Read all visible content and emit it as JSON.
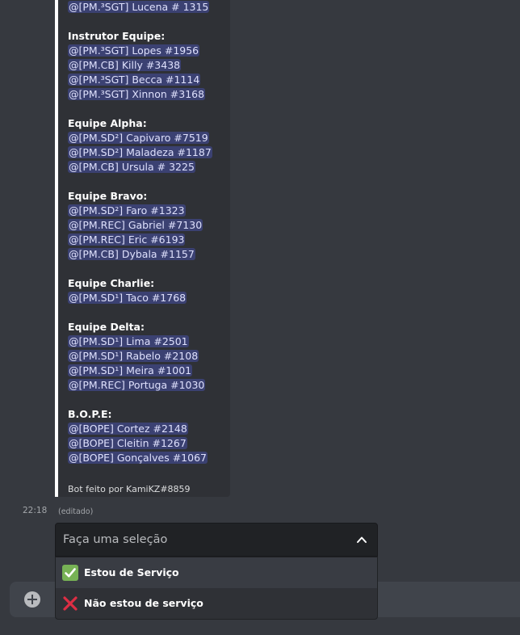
{
  "embed": {
    "first_mention": "@[PM.³SGT] Lucena # 1315",
    "sections": [
      {
        "title": "Instrutor Equipe:",
        "members": [
          "@[PM.³SGT] Lopes #1956",
          "@[PM.CB] Killy #3438",
          "@[PM.³SGT] Becca #1114",
          "@[PM.³SGT] Xinnon #3168"
        ]
      },
      {
        "title": "Equipe Alpha:",
        "members": [
          "@[PM.SD²] Capivaro #7519",
          "@[PM.SD²] Maladeza #1187",
          "@[PM.CB] Ursula # 3225"
        ]
      },
      {
        "title": "Equipe Bravo:",
        "members": [
          "@[PM.SD²] Faro #1323",
          "@[PM.REC] Gabriel #7130",
          "@[PM.REC] Eric #6193",
          "@[PM.CB] Dybala #1157"
        ]
      },
      {
        "title": "Equipe Charlie:",
        "members": [
          "@[PM.SD¹] Taco #1768"
        ]
      },
      {
        "title": "Equipe Delta:",
        "members": [
          "@[PM.SD¹] Lima #2501",
          "@[PM.SD¹] Rabelo #2108",
          "@[PM.SD¹] Meira #1001",
          "@[PM.REC] Portuga #1030"
        ]
      },
      {
        "title": "B.O.P.E:",
        "members": [
          "@[BOPE] Cortez #2148",
          "@[BOPE] Cleitin #1267",
          "@[BOPE] Gonçalves #1067"
        ]
      }
    ],
    "footer": "Bot feito por KamiKZ#8859"
  },
  "message": {
    "timestamp": "22:18",
    "edited": "(editado)"
  },
  "select": {
    "placeholder": "Faça uma seleção",
    "options": [
      {
        "label": "Estou de Serviço",
        "icon": "check-mark-icon",
        "color": "#77b255"
      },
      {
        "label": "Não estou de serviço",
        "icon": "cross-mark-icon",
        "color": "#dd2e44"
      }
    ]
  },
  "colors": {
    "background": "#36393f",
    "embed_bg": "#2f3136",
    "embed_border": "#ffffff",
    "mention_bg": "#5865f2",
    "select_bg": "#202225"
  }
}
